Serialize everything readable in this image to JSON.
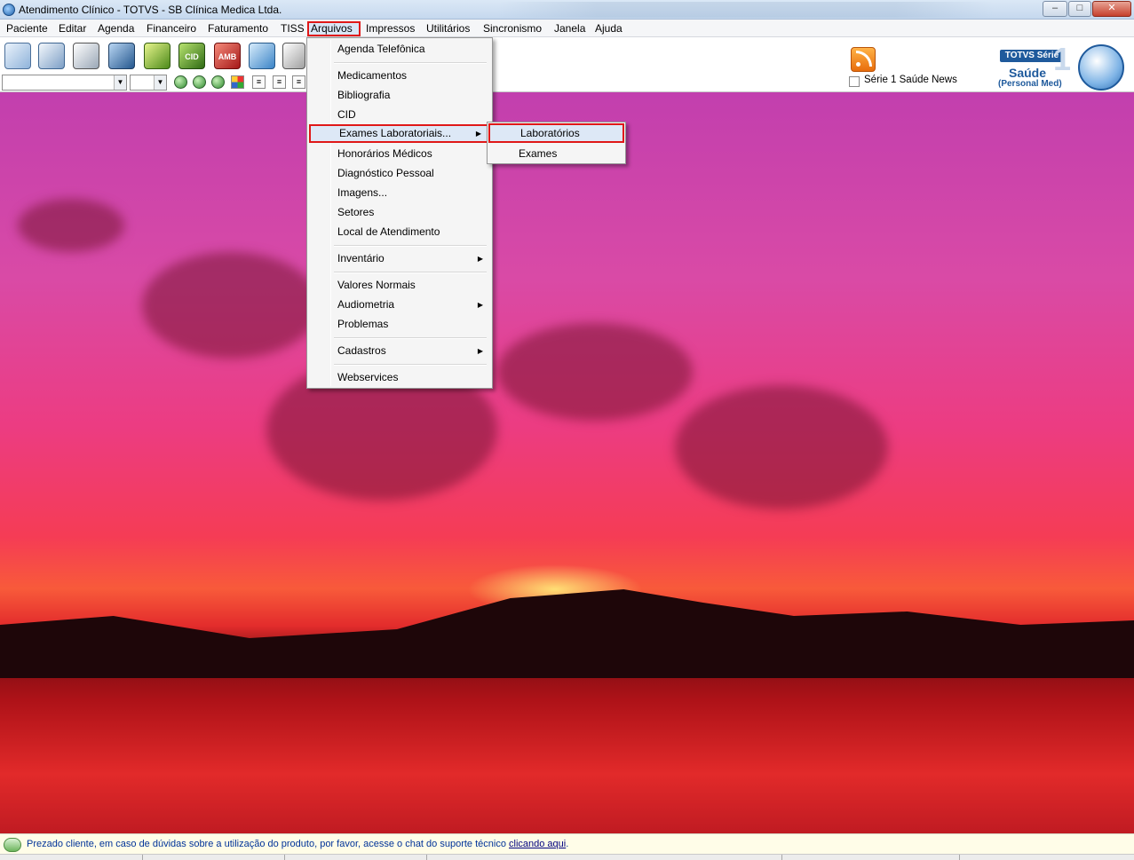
{
  "window": {
    "title": "Atendimento Clínico - TOTVS - SB Clínica Medica Ltda.",
    "minimize_glyph": "–",
    "maximize_glyph": "□",
    "close_glyph": "✕"
  },
  "menubar": {
    "items": [
      "Paciente",
      "Editar",
      "Agenda",
      "Financeiro",
      "Faturamento",
      "TISS",
      "Arquivos",
      "Impressos",
      "Utilitários",
      "Sincronismo",
      "Janela",
      "Ajuda"
    ],
    "active": "Arquivos"
  },
  "toolbar": {
    "icons": [
      "book-icon",
      "books-icon",
      "open-book-icon",
      "phone-book-icon",
      "money-icon",
      "cid-icon",
      "amb-icon",
      "lab-flask-icon",
      "tools-icon"
    ],
    "icon_labels": {
      "cid": "CID",
      "amb": "AMB"
    }
  },
  "news": {
    "checkbox_label": "Série 1 Saúde News",
    "checked": false
  },
  "logo": {
    "brand": "TOTVS Série",
    "number": "1",
    "product": "Saúde",
    "edition": "(Personal Med)"
  },
  "arquivos_menu": {
    "items": [
      {
        "label": "Agenda Telefônica"
      },
      {
        "label": "Medicamentos"
      },
      {
        "label": "Bibliografia"
      },
      {
        "label": "CID"
      },
      {
        "label": "Exames Laboratoriais...",
        "submenu": true,
        "selected": true
      },
      {
        "label": "Honorários Médicos"
      },
      {
        "label": "Diagnóstico Pessoal"
      },
      {
        "label": "Imagens..."
      },
      {
        "label": "Setores"
      },
      {
        "label": "Local de Atendimento"
      },
      {
        "label": "Inventário",
        "submenu": true
      },
      {
        "label": "Valores Normais"
      },
      {
        "label": "Audiometria",
        "submenu": true
      },
      {
        "label": "Problemas"
      },
      {
        "label": "Cadastros",
        "submenu": true
      },
      {
        "label": "Webservices"
      }
    ]
  },
  "exames_submenu": {
    "items": [
      {
        "label": "Laboratórios",
        "selected": true
      },
      {
        "label": "Exames"
      }
    ]
  },
  "status": {
    "message": "Prezado cliente, em caso de dúvidas sobre a utilização do produto, por favor, acesse o chat do suporte técnico ",
    "link": "clicando aqui",
    "tail": "."
  },
  "colors": {
    "highlight_border": "#e01818",
    "menu_hover": "#dde8f6",
    "status_text": "#003399"
  }
}
